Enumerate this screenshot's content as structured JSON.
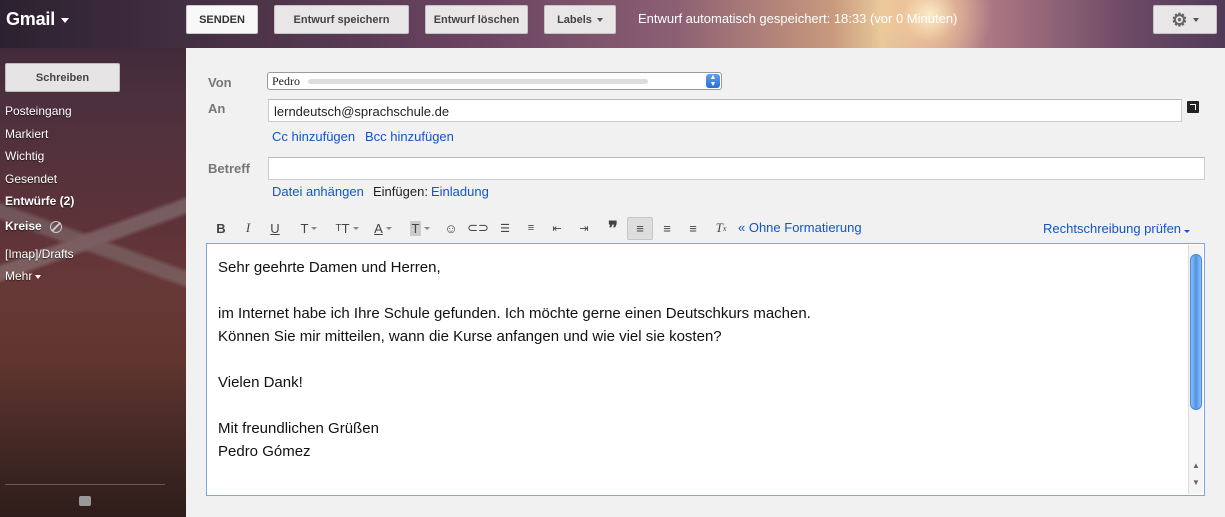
{
  "header": {
    "logo": "Gmail",
    "send_label": "SENDEN",
    "save_draft_label": "Entwurf speichern",
    "discard_draft_label": "Entwurf löschen",
    "labels_label": "Labels",
    "autosave_status": "Entwurf automatisch gespeichert: 18:33 (vor 0 Minuten)",
    "settings_icon": "gear-icon"
  },
  "sidebar": {
    "compose_label": "Schreiben",
    "items": [
      {
        "label": "Posteingang"
      },
      {
        "label": "Markiert"
      },
      {
        "label": "Wichtig"
      },
      {
        "label": "Gesendet"
      },
      {
        "label": "Entwürfe (2)"
      },
      {
        "label": "Kreise"
      },
      {
        "label": "[Imap]/Drafts"
      },
      {
        "label": "Mehr"
      }
    ]
  },
  "compose": {
    "from_label": "Von",
    "from_value": "Pedro",
    "to_label": "An",
    "to_value": "lerndeutsch@sprachschule.de",
    "cc_link": "Cc hinzufügen",
    "bcc_link": "Bcc hinzufügen",
    "subject_label": "Betreff",
    "subject_value": "",
    "attach_link": "Datei anhängen",
    "insert_label": "Einfügen:",
    "invite_link": "Einladung",
    "toolbar": {
      "bold": "B",
      "italic": "I",
      "underline": "U",
      "font": "T",
      "size": "T",
      "text_color": "A",
      "highlight": "T",
      "no_formatting": "« Ohne Formatierung",
      "spellcheck": "Rechtschreibung prüfen"
    },
    "body_lines": [
      "Sehr geehrte Damen und Herren,",
      "",
      "im Internet habe ich Ihre Schule gefunden. Ich möchte gerne einen Deutschkurs machen.",
      "Können Sie mir mitteilen, wann die Kurse anfangen und wie viel sie kosten?",
      "",
      "Vielen Dank!",
      "",
      "Mit freundlichen Grüßen",
      "Pedro Gómez",
      "",
      "--"
    ]
  },
  "colors": {
    "link": "#1155cc",
    "editor_border": "#7ba7e8",
    "main_bg": "#f1f1f1"
  }
}
